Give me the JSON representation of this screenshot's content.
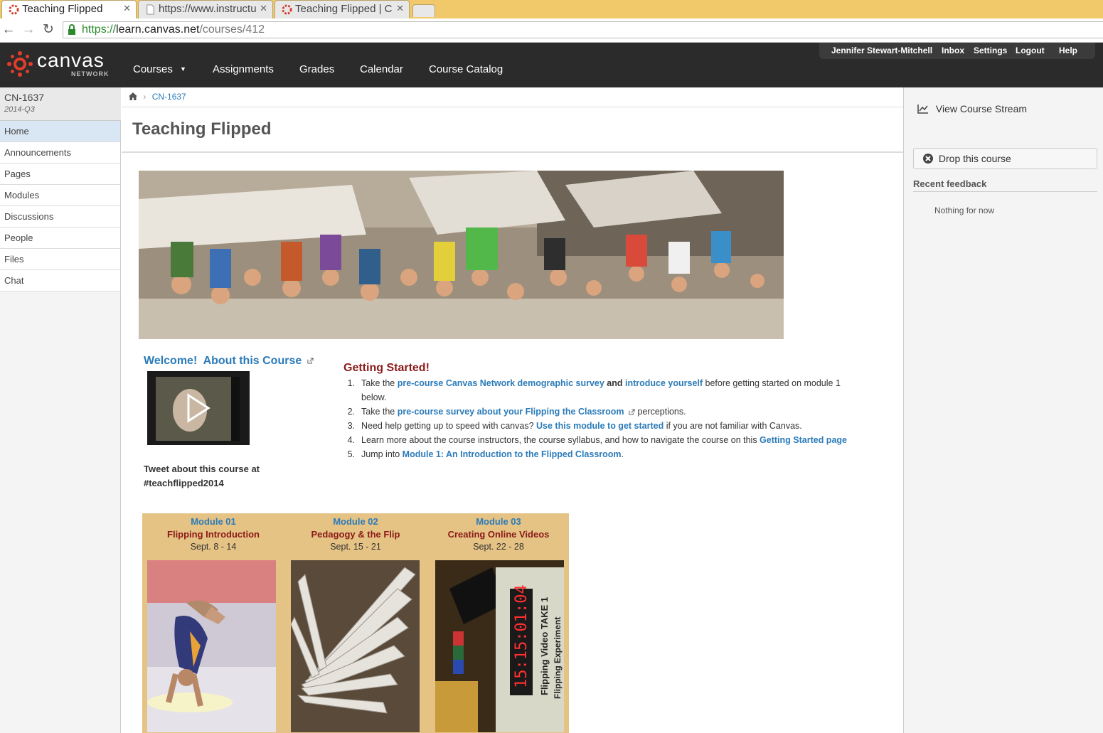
{
  "browser": {
    "tabs": [
      {
        "title": "Teaching Flipped",
        "active": true
      },
      {
        "title": "https://www.instructu",
        "active": false
      },
      {
        "title": "Teaching Flipped | C",
        "active": false
      }
    ],
    "url_scheme": "https://",
    "url_host": "learn.canvas.net",
    "url_path": "/courses/412"
  },
  "header": {
    "logo_text": "canvas",
    "logo_sub": "NETWORK",
    "nav": [
      "Courses",
      "Assignments",
      "Grades",
      "Calendar",
      "Course Catalog"
    ],
    "user_menu": [
      "Jennifer Stewart-Mitchell",
      "Inbox",
      "Settings",
      "Logout",
      "Help"
    ]
  },
  "sidebar": {
    "course_code": "CN-1637",
    "term": "2014-Q3",
    "items": [
      "Home",
      "Announcements",
      "Pages",
      "Modules",
      "Discussions",
      "People",
      "Files",
      "Chat"
    ],
    "active_item": "Home"
  },
  "main": {
    "breadcrumb": "CN-1637",
    "title": "Teaching Flipped",
    "welcome_a": "Welcome!",
    "welcome_b": "About this Course",
    "tweet_line1": "Tweet about this course at",
    "tweet_line2": "#teachflipped2014",
    "getting_started": {
      "title": "Getting Started!",
      "items": [
        {
          "num": "1.",
          "t1": "Take the ",
          "l1": "pre-course Canvas Network demographic survey",
          "t2": " and ",
          "l2": "introduce yourself",
          "t3": " before getting started on module 1",
          "t4": "below."
        },
        {
          "num": "2.",
          "t1": "Take the ",
          "l1": "pre-course survey about your Flipping the Classroom",
          "t2": " perceptions."
        },
        {
          "num": "3.",
          "t1": "Need help getting up to speed with canvas? ",
          "l1": "Use this module to get started",
          "t2": " if you are not familiar with Canvas."
        },
        {
          "num": "4.",
          "t1": "Learn more about the course instructors, the course syllabus, and how to navigate the course on this ",
          "l1": "Getting Started page"
        },
        {
          "num": "5.",
          "t1": "Jump into ",
          "l1": "Module 1: An Introduction to the Flipped Classroom",
          "t2": "."
        }
      ]
    },
    "modules": [
      {
        "num": "Module 01",
        "name": "Flipping Introduction",
        "dates": "Sept. 8 - 14"
      },
      {
        "num": "Module 02",
        "name": "Pedagogy & the Flip",
        "dates": "Sept. 15 - 21"
      },
      {
        "num": "Module 03",
        "name": "Creating Online Videos",
        "dates": "Sept. 22 - 28"
      }
    ],
    "slate_text": {
      "time": "15:15:01:04",
      "label1": "Flipping Video TAKE 1",
      "label2": "Flipping Experiment"
    }
  },
  "right": {
    "stream": "View Course Stream",
    "drop": "Drop this course",
    "feedback_title": "Recent feedback",
    "feedback_empty": "Nothing for now"
  },
  "colors": {
    "link": "#2b7bb9",
    "heading_red": "#8b1a1a",
    "header_bg": "#2b2b2b",
    "module_bg": "#e5c384",
    "active_nav": "#d9e7f4"
  }
}
